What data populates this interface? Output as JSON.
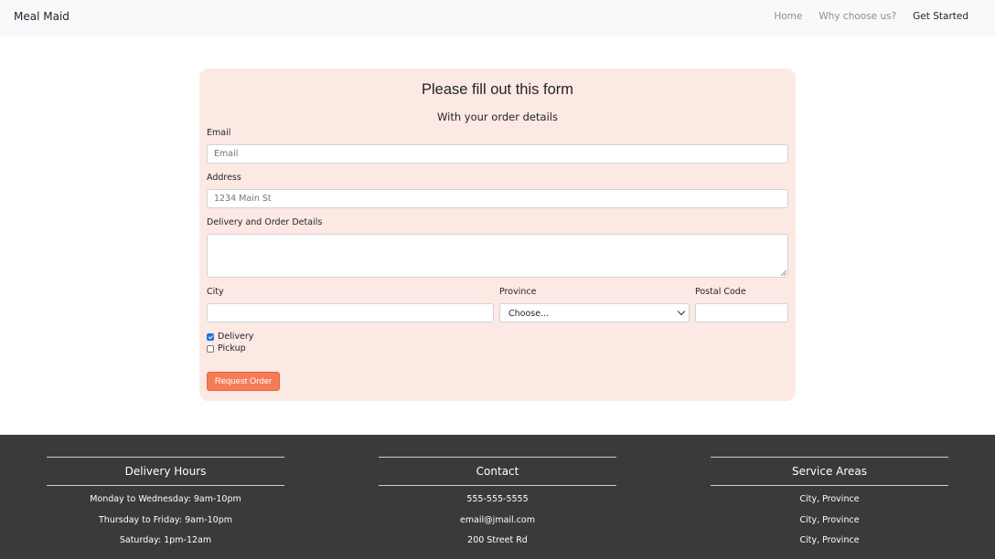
{
  "navbar": {
    "brand": "Meal Maid",
    "links": [
      {
        "label": "Home"
      },
      {
        "label": "Why choose us?"
      },
      {
        "label": "Get Started"
      }
    ]
  },
  "form": {
    "title": "Please fill out this form",
    "subtitle": "With your order details",
    "email": {
      "label": "Email",
      "placeholder": "Email",
      "value": ""
    },
    "address": {
      "label": "Address",
      "placeholder": "1234 Main St",
      "value": ""
    },
    "details": {
      "label": "Delivery and Order Details",
      "value": ""
    },
    "city": {
      "label": "City",
      "value": ""
    },
    "province": {
      "label": "Province",
      "selected": "Choose..."
    },
    "postal": {
      "label": "Postal Code",
      "value": ""
    },
    "delivery": {
      "label": "Delivery",
      "checked": true
    },
    "pickup": {
      "label": "Pickup",
      "checked": false
    },
    "submit_label": "Request Order"
  },
  "footer": {
    "columns": [
      {
        "heading": "Delivery Hours",
        "lines": [
          "Monday to Wednesday: 9am-10pm",
          "Thursday to Friday: 9am-10pm",
          "Saturday: 1pm-12am"
        ]
      },
      {
        "heading": "Contact",
        "lines": [
          "555-555-5555",
          "email@jmail.com",
          "200 Street Rd"
        ]
      },
      {
        "heading": "Service Areas",
        "lines": [
          "City, Province",
          "City, Province",
          "City, Province"
        ]
      }
    ]
  },
  "colors": {
    "accent": "#f47c56",
    "card_background": "#fde9e3",
    "footer_background": "#3a3a3a",
    "navbar_background": "#f8f9fa"
  }
}
